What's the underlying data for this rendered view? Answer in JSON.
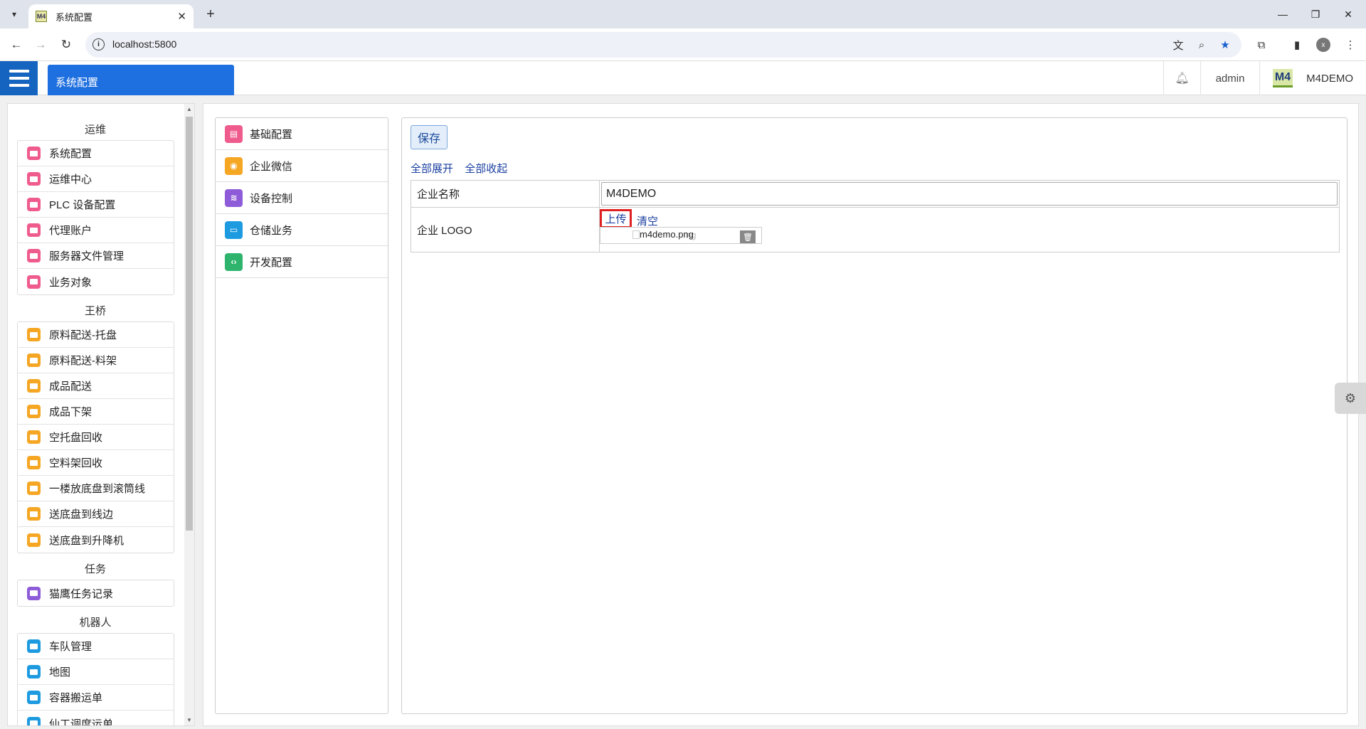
{
  "browser": {
    "tab_title": "系统配置",
    "favicon_text": "M4",
    "url": "localhost:5800",
    "profile_initial": "x"
  },
  "header": {
    "active_tab": "系统配置",
    "user": "admin",
    "brand_logo": "M4",
    "brand_name": "M4DEMO"
  },
  "sidebar": {
    "groups": [
      {
        "title": "运维",
        "color": "#ef5b8c",
        "items": [
          "系统配置",
          "运维中心",
          "PLC 设备配置",
          "代理账户",
          "服务器文件管理",
          "业务对象"
        ]
      },
      {
        "title": "王桥",
        "color": "#f5a623",
        "items": [
          "原料配送-托盘",
          "原料配送-料架",
          "成品配送",
          "成品下架",
          "空托盘回收",
          "空料架回收",
          "一楼放底盘到滚筒线",
          "送底盘到线边",
          "送底盘到升降机"
        ]
      },
      {
        "title": "任务",
        "color": "#8e5bd9",
        "items": [
          "猫鹰任务记录"
        ]
      },
      {
        "title": "机器人",
        "color": "#1e9be0",
        "items": [
          "车队管理",
          "地图",
          "容器搬运单",
          "仙工调度运单"
        ]
      }
    ]
  },
  "config_nav": [
    {
      "label": "基础配置",
      "color": "#ef5b8c",
      "icon": "document-icon"
    },
    {
      "label": "企业微信",
      "color": "#f5a623",
      "icon": "wechat-icon"
    },
    {
      "label": "设备控制",
      "color": "#8e5bd9",
      "icon": "router-icon"
    },
    {
      "label": "仓储业务",
      "color": "#1e9be0",
      "icon": "monitor-icon"
    },
    {
      "label": "开发配置",
      "color": "#2fb46e",
      "icon": "code-icon"
    }
  ],
  "form": {
    "save_label": "保存",
    "expand_all": "全部展开",
    "collapse_all": "全部收起",
    "company_name_label": "企业名称",
    "company_name_value": "M4DEMO",
    "logo_label": "企业 LOGO",
    "upload_label": "上传",
    "clear_label": "清空",
    "file_name": "m4demo.png",
    "file_name_ghost": "ng"
  }
}
